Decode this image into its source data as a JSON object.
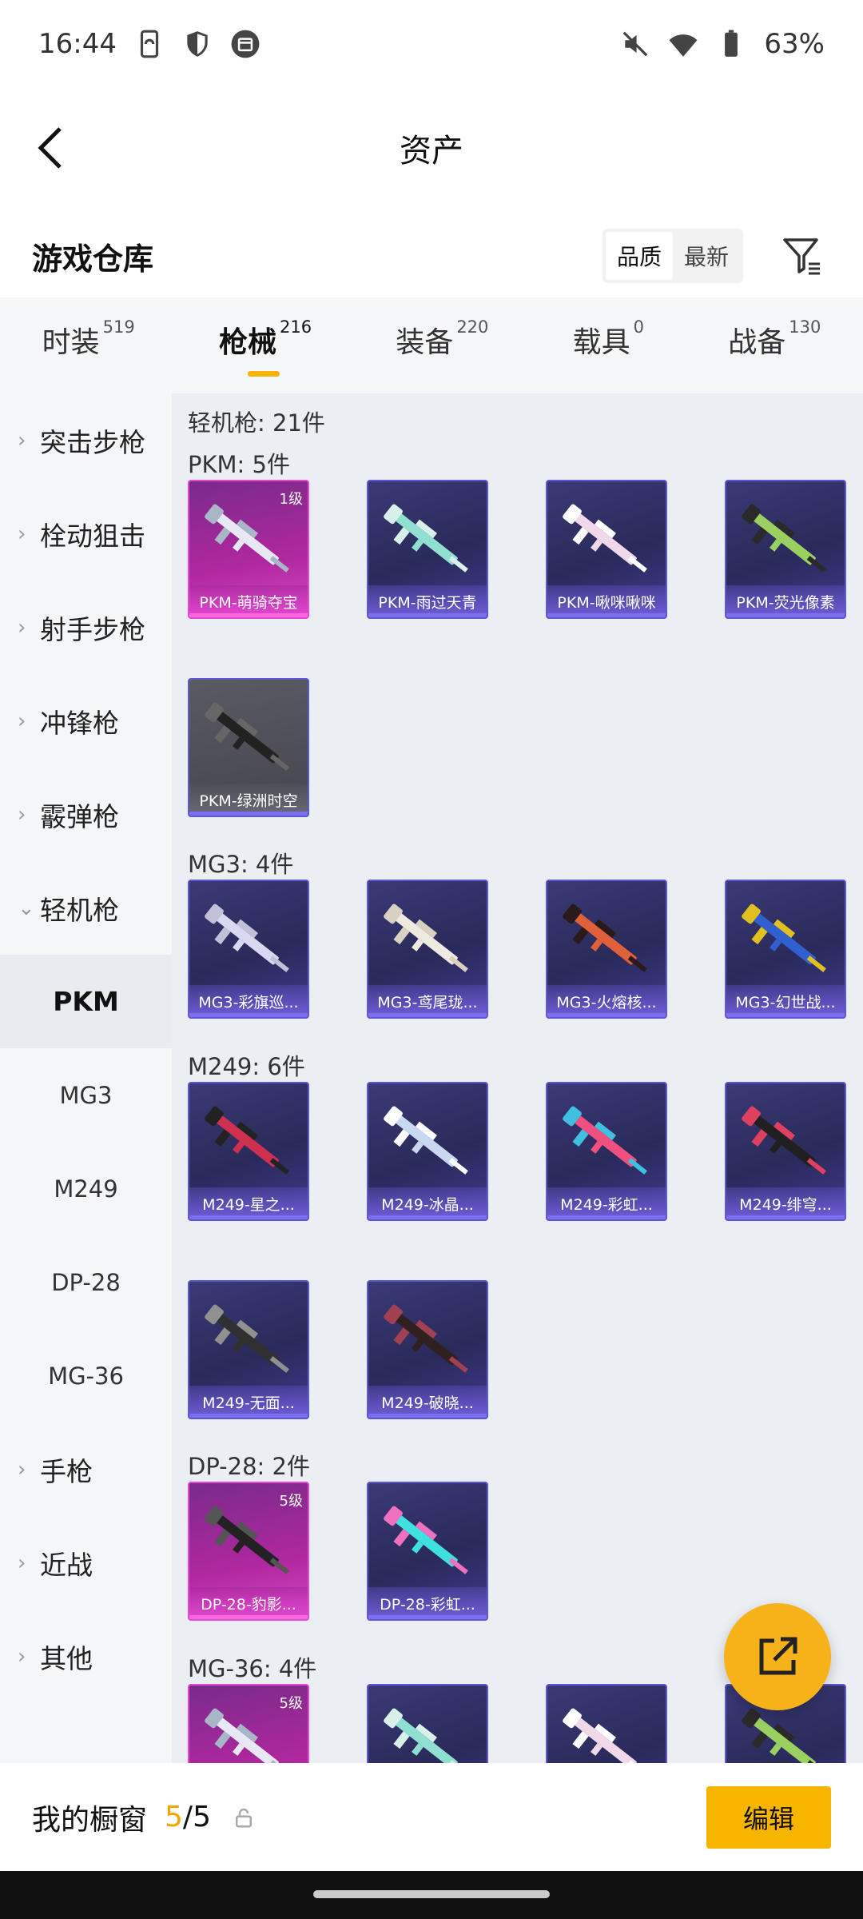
{
  "status_bar": {
    "time": "16:44",
    "battery": "63%",
    "icons": [
      "phone-sync-icon",
      "shield-icon",
      "calendar-icon",
      "mute-icon",
      "wifi-icon",
      "battery-icon"
    ]
  },
  "header": {
    "title": "资产"
  },
  "warehouse": {
    "title": "游戏仓库",
    "sort_options": [
      "品质",
      "最新"
    ],
    "active_sort": "品质"
  },
  "category_tabs": [
    {
      "label": "时装",
      "count": "519",
      "active": false
    },
    {
      "label": "枪械",
      "count": "216",
      "active": true
    },
    {
      "label": "装备",
      "count": "220",
      "active": false
    },
    {
      "label": "载具",
      "count": "0",
      "active": false
    },
    {
      "label": "战备",
      "count": "130",
      "active": false
    }
  ],
  "sidebar": {
    "items": [
      {
        "label": "突击步枪",
        "expanded": false
      },
      {
        "label": "栓动狙击",
        "expanded": false
      },
      {
        "label": "射手步枪",
        "expanded": false
      },
      {
        "label": "冲锋枪",
        "expanded": false
      },
      {
        "label": "霰弹枪",
        "expanded": false
      },
      {
        "label": "轻机枪",
        "expanded": true
      }
    ],
    "sub_items": [
      "PKM",
      "MG3",
      "M249",
      "DP-28",
      "MG-36"
    ],
    "selected_sub": "PKM",
    "items_after": [
      {
        "label": "手枪"
      },
      {
        "label": "近战"
      },
      {
        "label": "其他"
      }
    ]
  },
  "content": {
    "category_summary": "轻机枪: 21件",
    "groups": [
      {
        "title": "PKM: 5件",
        "cards": [
          {
            "name": "PKM-萌骑夺宝",
            "rarity": "pink",
            "level": "1级"
          },
          {
            "name": "PKM-雨过天青",
            "rarity": "purple",
            "level": ""
          },
          {
            "name": "PKM-啾咪啾咪",
            "rarity": "purple",
            "level": ""
          },
          {
            "name": "PKM-荧光像素",
            "rarity": "purple",
            "level": ""
          },
          {
            "name": "PKM-绿洲时空",
            "rarity": "gray",
            "level": ""
          }
        ]
      },
      {
        "title": "MG3: 4件",
        "cards": [
          {
            "name": "MG3-彩旗巡...",
            "rarity": "purple",
            "level": ""
          },
          {
            "name": "MG3-鸢尾珑...",
            "rarity": "purple",
            "level": ""
          },
          {
            "name": "MG3-火熔核...",
            "rarity": "purple",
            "level": ""
          },
          {
            "name": "MG3-幻世战...",
            "rarity": "purple",
            "level": ""
          }
        ]
      },
      {
        "title": "M249: 6件",
        "cards": [
          {
            "name": "M249-星之...",
            "rarity": "purple",
            "level": ""
          },
          {
            "name": "M249-冰晶...",
            "rarity": "purple",
            "level": ""
          },
          {
            "name": "M249-彩虹...",
            "rarity": "purple",
            "level": ""
          },
          {
            "name": "M249-绯穹...",
            "rarity": "purple",
            "level": ""
          },
          {
            "name": "M249-无面...",
            "rarity": "purple",
            "level": ""
          },
          {
            "name": "M249-破晓...",
            "rarity": "purple",
            "level": ""
          }
        ]
      },
      {
        "title": "DP-28: 2件",
        "cards": [
          {
            "name": "DP-28-豹影...",
            "rarity": "pink",
            "level": "5级"
          },
          {
            "name": "DP-28-彩虹...",
            "rarity": "purple",
            "level": ""
          }
        ]
      },
      {
        "title": "MG-36: 4件",
        "cards": [
          {
            "name": "",
            "rarity": "pink",
            "level": "5级"
          },
          {
            "name": "",
            "rarity": "purple",
            "level": ""
          },
          {
            "name": "",
            "rarity": "purple",
            "level": ""
          },
          {
            "name": "",
            "rarity": "purple",
            "level": ""
          }
        ]
      }
    ]
  },
  "fab": {
    "icon": "share-icon"
  },
  "bottom_bar": {
    "label": "我的橱窗",
    "current": "5",
    "separator": "/",
    "total": "5",
    "edit_label": "编辑"
  },
  "colors": {
    "accent": "#f7b500",
    "rare_pink": "#e44ad0",
    "rare_purple": "#5d56d6"
  }
}
